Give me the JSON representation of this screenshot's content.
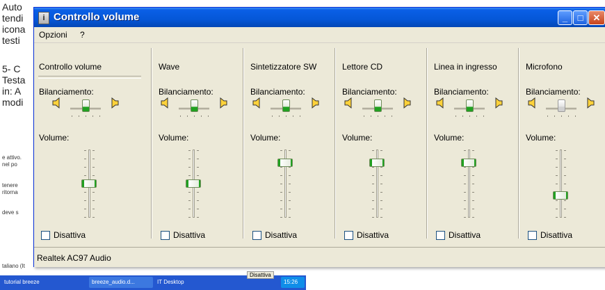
{
  "background": {
    "lines": [
      "Auto",
      "tendi",
      "icona",
      "testi",
      "5- C",
      "Testa",
      "in: A",
      "modi"
    ],
    "small_lines": [
      "e attivo.",
      "nel po",
      "tenere",
      "ritorna",
      "deve s",
      "taliano (It"
    ],
    "taskbar_items": [
      "tutorial breeze",
      "breeze_audio.d...",
      "IT Desktop",
      "15:26"
    ],
    "ghost_checkbox": "Disattiva"
  },
  "window": {
    "title": "Controllo volume",
    "title_icon": "volume-control-app-icon",
    "menu": [
      "Opzioni",
      "?"
    ],
    "status": "Realtek AC97 Audio"
  },
  "labels": {
    "balance": "Bilanciamento:",
    "volume": "Volume:",
    "mute": "Disattiva"
  },
  "channels": [
    {
      "name": "Controllo volume",
      "balance": 0.5,
      "volume": 0.5,
      "balance_active": true,
      "muted": false
    },
    {
      "name": "Wave",
      "balance": 0.5,
      "volume": 0.5,
      "balance_active": true,
      "muted": false
    },
    {
      "name": "Sintetizzatore SW",
      "balance": 0.5,
      "volume": 0.85,
      "balance_active": true,
      "muted": false
    },
    {
      "name": "Lettore CD",
      "balance": 0.5,
      "volume": 0.85,
      "balance_active": true,
      "muted": false
    },
    {
      "name": "Linea in ingresso",
      "balance": 0.5,
      "volume": 0.85,
      "balance_active": true,
      "muted": false
    },
    {
      "name": "Microfono",
      "balance": 0.5,
      "volume": 0.3,
      "balance_active": false,
      "muted": false
    }
  ],
  "colors": {
    "titlebar": "#0557d8",
    "window_bg": "#ece9d8",
    "thumb_green": "#21a121"
  }
}
